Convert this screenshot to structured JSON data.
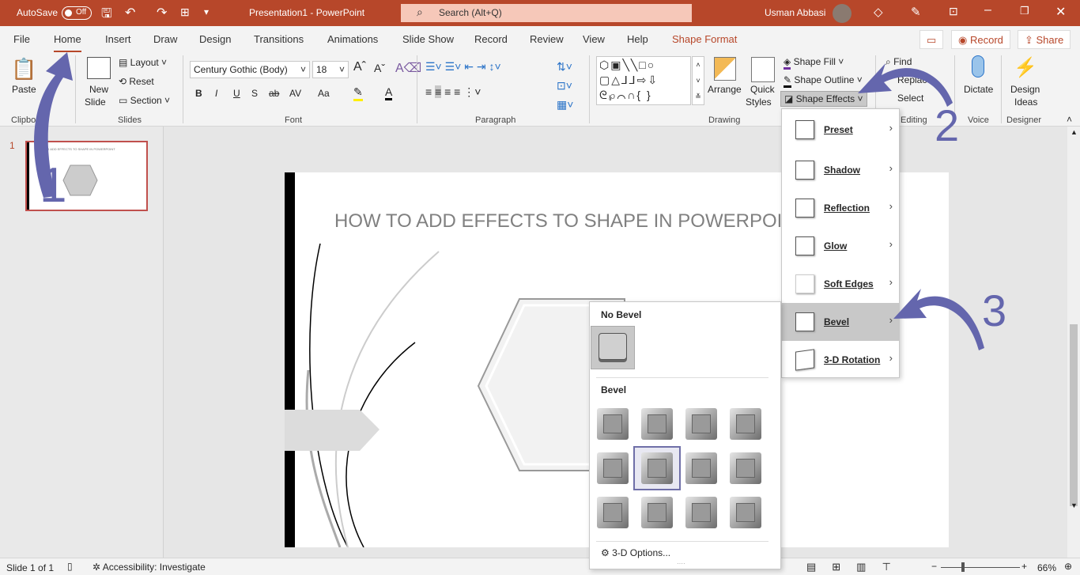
{
  "titlebar": {
    "autosave": "AutoSave",
    "toggle": "Off",
    "title": "Presentation1  -  PowerPoint",
    "search_placeholder": "Search (Alt+Q)",
    "user": "Usman Abbasi"
  },
  "tabs": [
    {
      "label": "File"
    },
    {
      "label": "Home",
      "active": true
    },
    {
      "label": "Insert"
    },
    {
      "label": "Draw"
    },
    {
      "label": "Design"
    },
    {
      "label": "Transitions"
    },
    {
      "label": "Animations"
    },
    {
      "label": "Slide Show"
    },
    {
      "label": "Record"
    },
    {
      "label": "Review"
    },
    {
      "label": "View"
    },
    {
      "label": "Help"
    },
    {
      "label": "Shape Format",
      "contextual": true
    }
  ],
  "top_buttons": {
    "record": "Record",
    "share": "Share"
  },
  "ribbon": {
    "clipboard": {
      "paste": "Paste",
      "group": "Clipboard"
    },
    "slides": {
      "new_slide": "New",
      "new_slide2": "Slide",
      "layout": "Layout",
      "reset": "Reset",
      "section": "Section",
      "group": "Slides"
    },
    "font": {
      "font_name": "Century Gothic (Body)",
      "font_size": "18",
      "bold": "B",
      "italic": "I",
      "underline": "U",
      "shadow": "S",
      "strike": "ab",
      "spacing": "AV",
      "case": "Aa",
      "group": "Font"
    },
    "paragraph": {
      "group": "Paragraph"
    },
    "drawing": {
      "arrange": "Arrange",
      "quick": "Quick",
      "styles": "Styles",
      "shape_fill": "Shape Fill",
      "shape_outline": "Shape Outline",
      "shape_effects": "Shape Effects",
      "group": "Drawing"
    },
    "editing": {
      "find": "Find",
      "replace": "Replace",
      "select": "Select",
      "group": "Editing"
    },
    "voice": {
      "dictate": "Dictate",
      "group": "Voice"
    },
    "designer": {
      "design": "Design",
      "ideas": "Ideas",
      "group": "Designer"
    }
  },
  "thumbnails": [
    {
      "number": "1",
      "title": "HOW TO ADD EFFECTS TO SHAPE IN POWERPOINT"
    }
  ],
  "slide": {
    "title": "HOW TO ADD EFFECTS TO SHAPE IN POWERPOINT"
  },
  "shape_effects_menu": [
    {
      "label": "Preset"
    },
    {
      "label": "Shadow"
    },
    {
      "label": "Reflection"
    },
    {
      "label": "Glow"
    },
    {
      "label": "Soft Edges"
    },
    {
      "label": "Bevel",
      "highlighted": true
    },
    {
      "label": "3-D Rotation"
    }
  ],
  "bevel_menu": {
    "no_bevel": "No Bevel",
    "bevel": "Bevel",
    "options": "3-D Options...",
    "selected_index": 5
  },
  "annotations": {
    "n1": "1",
    "n2": "2",
    "n3": "3",
    "color": "#6466ad"
  },
  "status": {
    "slide": "Slide 1 of 1",
    "accessibility": "Accessibility: Investigate",
    "zoom": "66%"
  },
  "colors": {
    "accent": "#b7472a"
  }
}
